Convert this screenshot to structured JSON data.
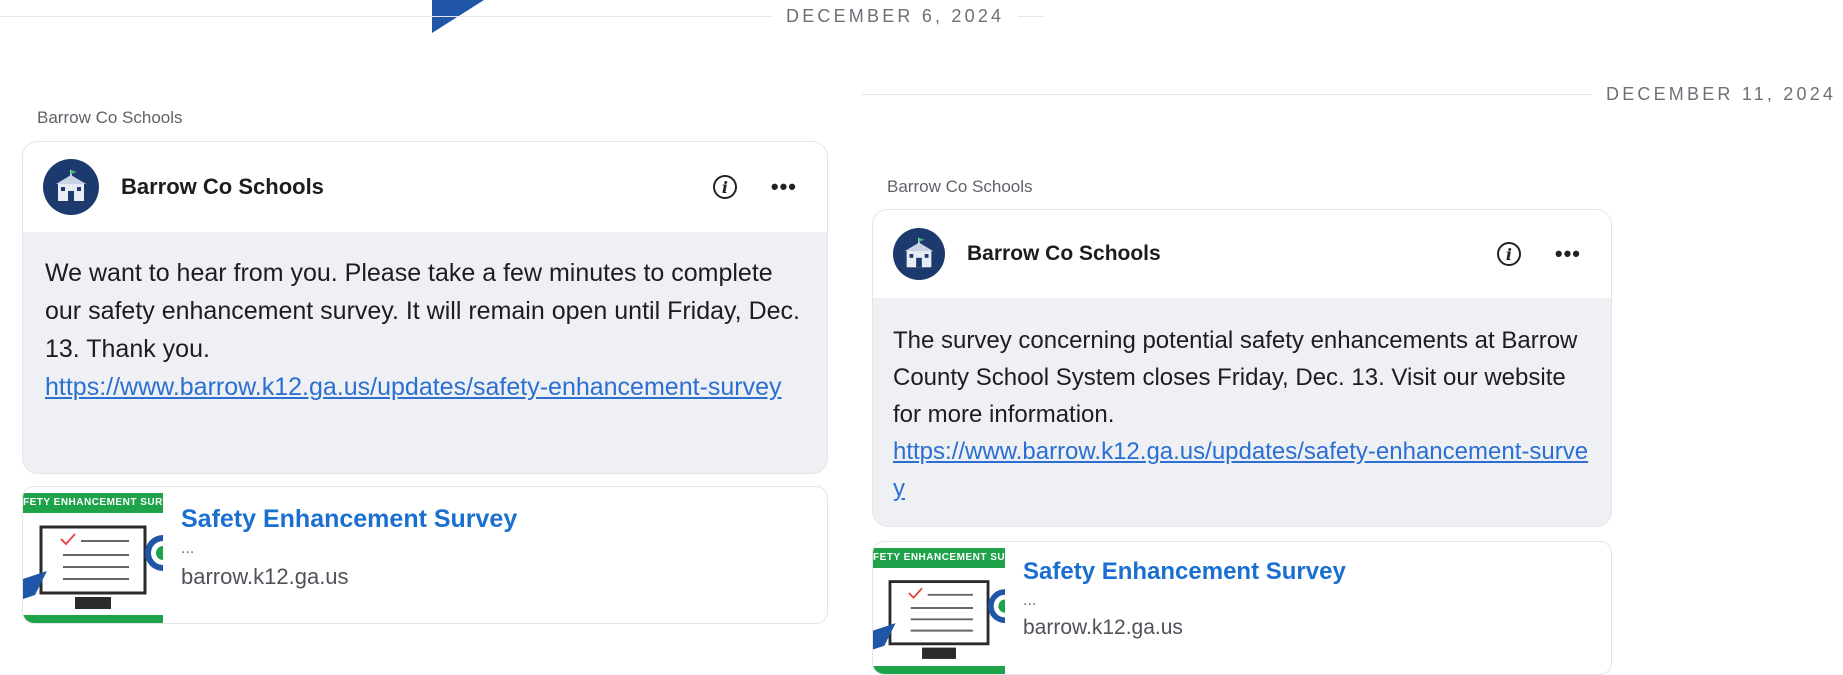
{
  "dates": {
    "left": "DECEMBER 6, 2024",
    "right": "DECEMBER 11, 2024"
  },
  "posts": [
    {
      "author_label": "Barrow Co Schools",
      "author_name": "Barrow Co Schools",
      "body_text": "We want to hear from you. Please take a few minutes to complete our safety enhancement survey. It will remain open until Friday, Dec. 13. Thank you.",
      "link": "https://www.barrow.k12.ga.us/updates/safety-enhancement-survey",
      "preview": {
        "banner": "FETY ENHANCEMENT SURV",
        "title": "Safety Enhancement Survey",
        "desc": "...",
        "domain": "barrow.k12.ga.us"
      }
    },
    {
      "author_label": "Barrow Co Schools",
      "author_name": "Barrow Co Schools",
      "body_text": "The survey concerning potential safety enhancements at Barrow County School System closes Friday, Dec. 13. Visit our website for more information.",
      "link": "https://www.barrow.k12.ga.us/updates/safety-enhancement-survey",
      "preview": {
        "banner": "FETY ENHANCEMENT SURV",
        "title": "Safety Enhancement Survey",
        "desc": "...",
        "domain": "barrow.k12.ga.us"
      }
    }
  ],
  "icons": {
    "info": "info-icon",
    "more": "more-options-icon",
    "avatar": "school-building-icon"
  },
  "colors": {
    "link": "#2a6fd1",
    "preview_title": "#1a6fd0",
    "avatar_bg": "#1c3a6d",
    "banner_green": "#1ea24a",
    "accent_blue": "#1f56a8"
  }
}
